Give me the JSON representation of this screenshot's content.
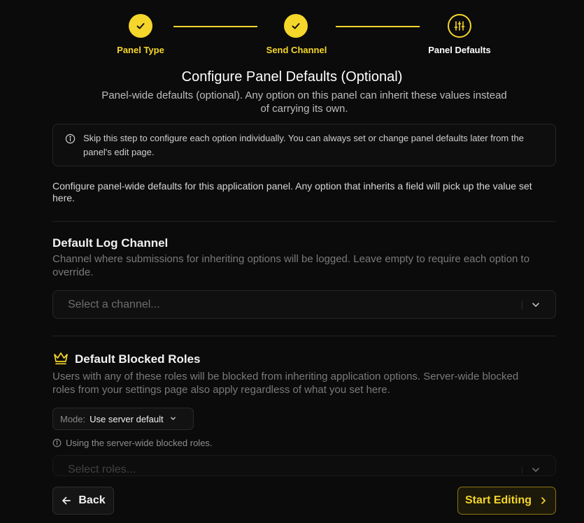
{
  "colors": {
    "accent": "#f5d62a",
    "background": "#0b0b0b",
    "muted_text": "#7a7a7a"
  },
  "stepper": {
    "steps": [
      {
        "label": "Panel Type",
        "status": "done",
        "icon": "check-icon"
      },
      {
        "label": "Send Channel",
        "status": "done",
        "icon": "check-icon"
      },
      {
        "label": "Panel Defaults",
        "status": "active",
        "icon": "sliders-icon"
      }
    ]
  },
  "header": {
    "title": "Configure Panel Defaults (Optional)",
    "subtitle": "Panel-wide defaults (optional). Any option on this panel can inherit these values instead of carrying its own."
  },
  "info": {
    "icon": "info-icon",
    "text": "Skip this step to configure each option individually. You can always set or change panel defaults later from the panel's edit page."
  },
  "intro": "Configure panel-wide defaults for this application panel. Any option that inherits a field will pick up the value set here.",
  "log_channel": {
    "title": "Default Log Channel",
    "description": "Channel where submissions for inheriting options will be logged. Leave empty to require each option to override.",
    "placeholder": "Select a channel..."
  },
  "blocked_roles": {
    "icon": "crown-icon",
    "title": "Default Blocked Roles",
    "description": "Users with any of these roles will be blocked from inheriting application options. Server-wide blocked roles from your settings page also apply regardless of what you set here.",
    "mode_label": "Mode:",
    "mode_value": "Use server default",
    "note": "Using the server-wide blocked roles.",
    "placeholder": "Select roles..."
  },
  "footer": {
    "back_label": "Back",
    "start_label": "Start Editing"
  }
}
